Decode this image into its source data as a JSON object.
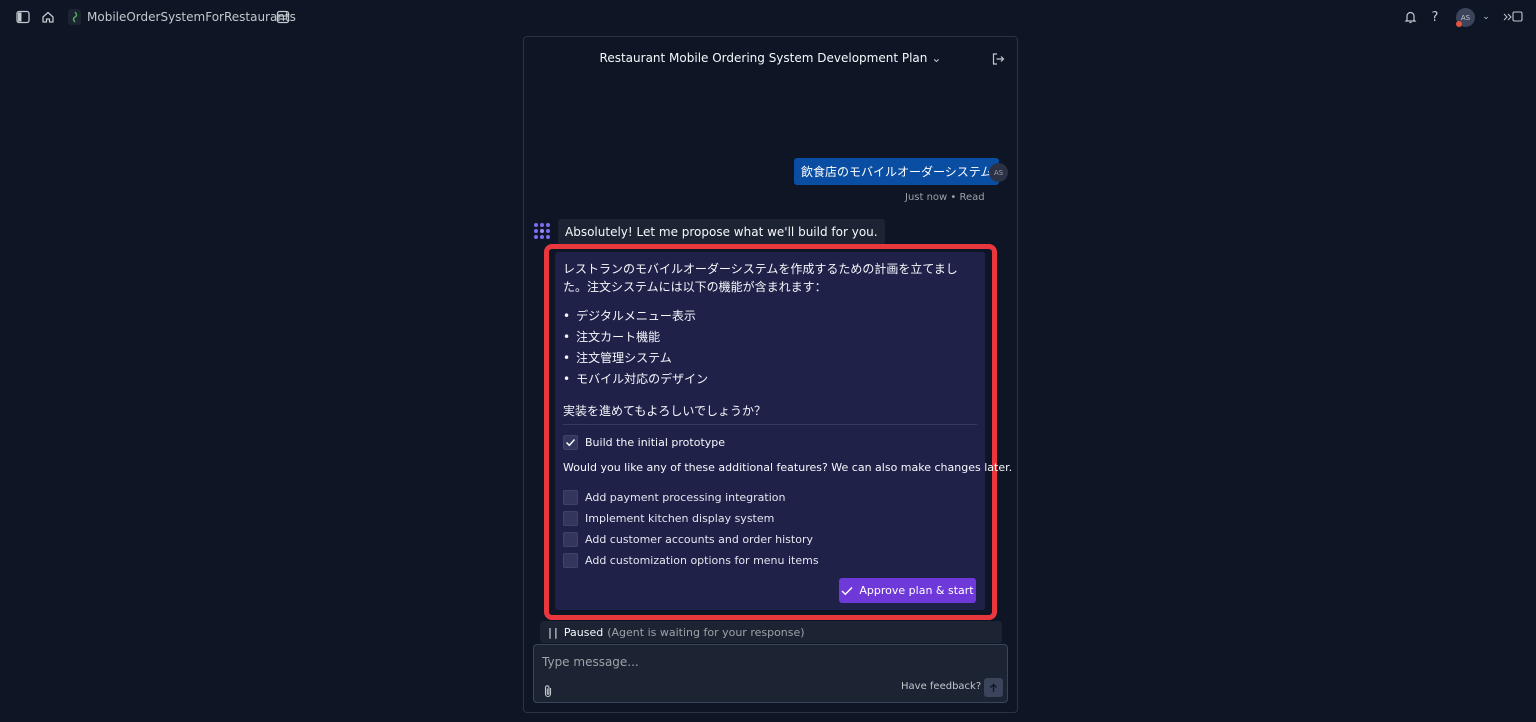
{
  "topbar": {
    "project_name": "MobileOrderSystemForRestaurants",
    "avatar_initials": "AS"
  },
  "panel": {
    "title": "Restaurant Mobile Ordering System Development Plan"
  },
  "user_message": {
    "text": "飲食店のモバイルオーダーシステム",
    "avatar_initials": "AS",
    "meta": "Just now • Read"
  },
  "agent_message": {
    "text": "Absolutely! Let me propose what we'll build for you."
  },
  "plan": {
    "intro": "レストランのモバイルオーダーシステムを作成するための計画を立てました。注文システムには以下の機能が含まれます：",
    "items": [
      "デジタルメニュー表示",
      "注文カート機能",
      "注文管理システム",
      "モバイル対応のデザイン"
    ],
    "question": "実装を進めてもよろしいでしょうか？",
    "prototype_label": "Build the initial prototype",
    "prototype_checked": true,
    "features_question": "Would you like any of these additional features? We can also make changes later.",
    "features": [
      {
        "label": "Add payment processing integration",
        "checked": false
      },
      {
        "label": "Implement kitchen display system",
        "checked": false
      },
      {
        "label": "Add customer accounts and order history",
        "checked": false
      },
      {
        "label": "Add customization options for menu items",
        "checked": false
      }
    ],
    "approve_label": "Approve plan & start"
  },
  "status": {
    "label": "Paused",
    "sub": "(Agent is waiting for your response)"
  },
  "composer": {
    "placeholder": "Type message...",
    "feedback_label": "Have feedback?"
  },
  "colors": {
    "background": "#0e1525",
    "user_bubble": "#0a4ea3",
    "plan_card": "#1f2148",
    "highlight": "#e8383d",
    "approve_button": "#6e39d8"
  }
}
